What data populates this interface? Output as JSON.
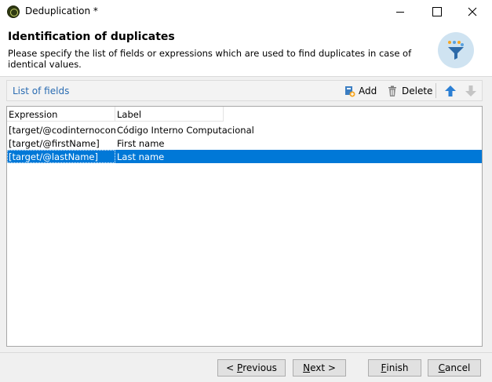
{
  "window": {
    "title": "Deduplication *"
  },
  "header": {
    "title": "Identification of duplicates",
    "description": "Please specify the list of fields or expressions which are used to find duplicates in case of identical values.",
    "icon": "funnel-icon"
  },
  "toolbar": {
    "title": "List of fields",
    "add_label": "Add",
    "delete_label": "Delete"
  },
  "grid": {
    "columns": [
      "Expression",
      "Label"
    ],
    "rows": [
      {
        "expression": "[target/@codinternocom...",
        "label": "Código Interno Computacional"
      },
      {
        "expression": "[target/@firstName]",
        "label": "First name"
      },
      {
        "expression": "[target/@lastName]",
        "label": "Last name"
      }
    ],
    "selected_index": 2
  },
  "buttons": {
    "previous": {
      "prefix": "< ",
      "key": "P",
      "rest": "revious"
    },
    "next": {
      "key": "N",
      "rest": "ext >"
    },
    "finish": {
      "key": "F",
      "rest": "inish"
    },
    "cancel": {
      "key": "C",
      "rest": "ancel"
    }
  },
  "colors": {
    "selection": "#0078d7",
    "link_blue": "#2a6cb2",
    "arrow_up": "#2b7fd4",
    "arrow_down_disabled": "#c4c4c4"
  }
}
